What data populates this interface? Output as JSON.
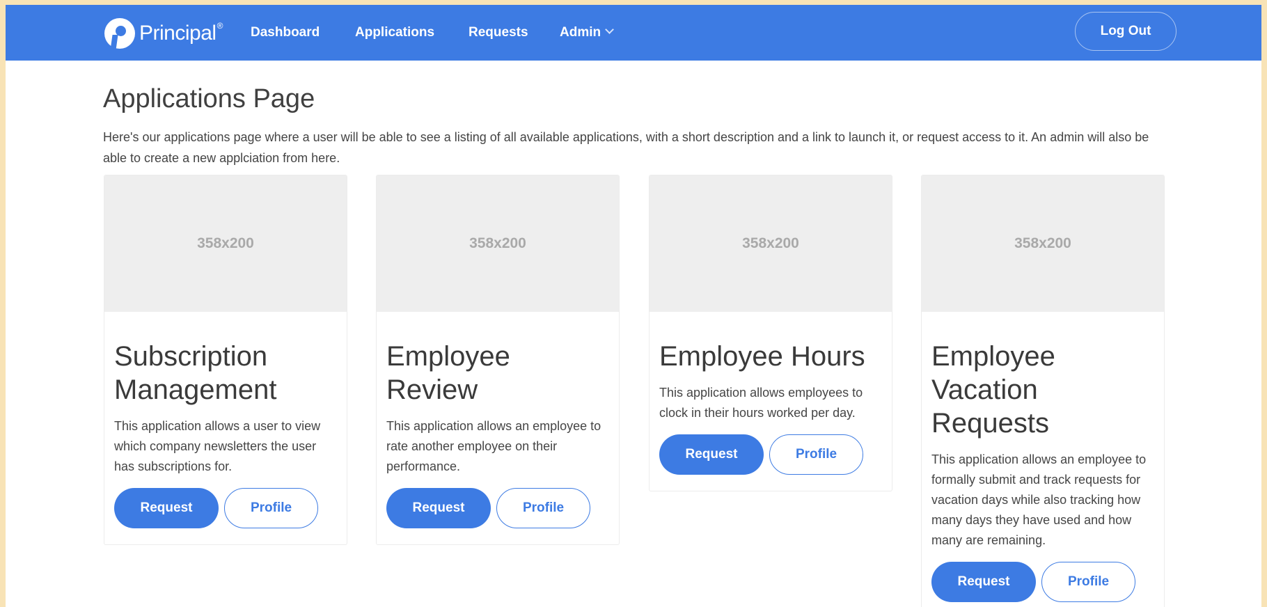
{
  "nav": {
    "logo_text": "Principal",
    "logo_reg": "®",
    "links": [
      "Dashboard",
      "Applications",
      "Requests",
      "Admin"
    ],
    "logout": "Log Out"
  },
  "page": {
    "title": "Applications Page",
    "description": "Here's our applications page where a user will be able to see a listing of all available applications, with a short description and a link to launch it, or request access to it. An admin will also be able to create a new applciation from here."
  },
  "cards": [
    {
      "image_label": "358x200",
      "title": "Subscription Management",
      "description": "This application allows a user to view which company newsletters the user has subscriptions for.",
      "request_label": "Request",
      "profile_label": "Profile"
    },
    {
      "image_label": "358x200",
      "title": "Employee Review",
      "description": "This application allows an employee to rate another employee on their performance.",
      "request_label": "Request",
      "profile_label": "Profile"
    },
    {
      "image_label": "358x200",
      "title": "Employee Hours",
      "description": "This application allows employees to clock in their hours worked per day.",
      "request_label": "Request",
      "profile_label": "Profile"
    },
    {
      "image_label": "358x200",
      "title": "Employee Vacation Requests",
      "description": "This application allows an employee to formally submit and track requests for vacation days while also tracking how many days they have used and how many are remaining.",
      "request_label": "Request",
      "profile_label": "Profile"
    }
  ],
  "colors": {
    "brand": "#3d7be3",
    "placeholder": "#eeeeee"
  }
}
